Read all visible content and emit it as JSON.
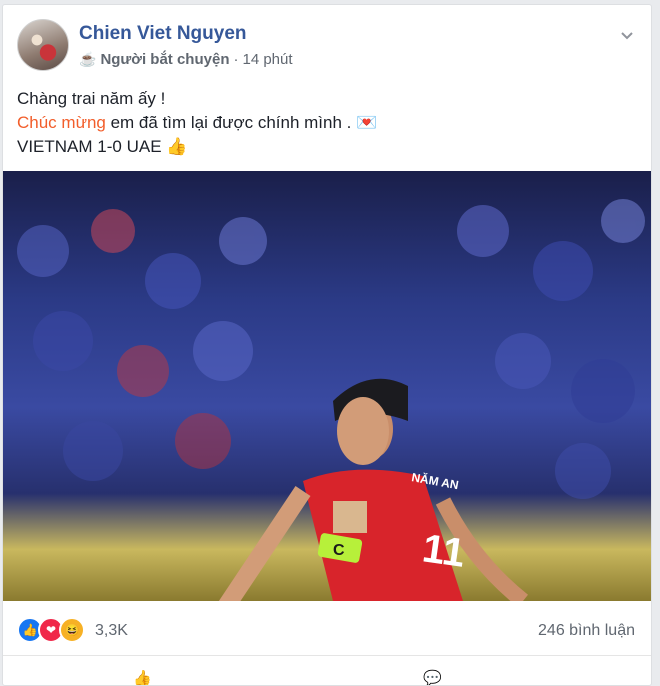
{
  "post": {
    "author": "Chien Viet Nguyen",
    "group_icon": "coffee-cup-icon",
    "group": "Người bắt chuyện",
    "separator": "·",
    "time": "14 phút",
    "line1": "Chàng trai năm ấy !",
    "line2_accent": "Chúc mừng",
    "line2_rest": " em đã tìm lại được chính mình . 💌",
    "line3": "VIETNAM 1-0 UAE 👍",
    "photo": {
      "jersey_name": "NĂM AN",
      "jersey_number": "11",
      "armband": "C"
    }
  },
  "reactions": {
    "icons": [
      "like-icon",
      "love-icon",
      "haha-icon"
    ],
    "count": "3,3K",
    "comments": "246 bình luận"
  },
  "colors": {
    "name": "#365899",
    "accent": "#f25e2b",
    "jersey": "#d8242b",
    "armband": "#b7f03a"
  }
}
